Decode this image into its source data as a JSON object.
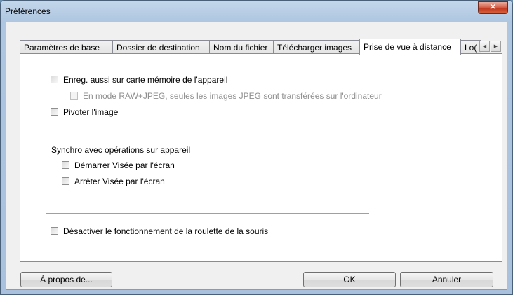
{
  "window": {
    "title": "Préférences",
    "close_glyph": "✕"
  },
  "tabs": [
    {
      "label": "Paramètres de base"
    },
    {
      "label": "Dossier de destination"
    },
    {
      "label": "Nom du fichier"
    },
    {
      "label": "Télécharger images"
    },
    {
      "label": "Prise de vue à distance",
      "active": true
    },
    {
      "label": "Lo("
    }
  ],
  "tab_scroll": {
    "left": "◀",
    "right": "▶"
  },
  "options": {
    "save_to_card": "Enreg. aussi sur carte mémoire de l'appareil",
    "raw_jpeg": "En mode RAW+JPEG, seules les images JPEG sont transférées sur l'ordinateur",
    "rotate": "Pivoter l'image",
    "sync_heading": "Synchro avec opérations sur appareil",
    "start_liveview": "Démarrer Visée par l'écran",
    "stop_liveview": "Arrêter Visée par l'écran",
    "disable_wheel": "Désactiver le fonctionnement de la roulette de la souris"
  },
  "buttons": {
    "about": "À propos de...",
    "ok": "OK",
    "cancel": "Annuler"
  }
}
